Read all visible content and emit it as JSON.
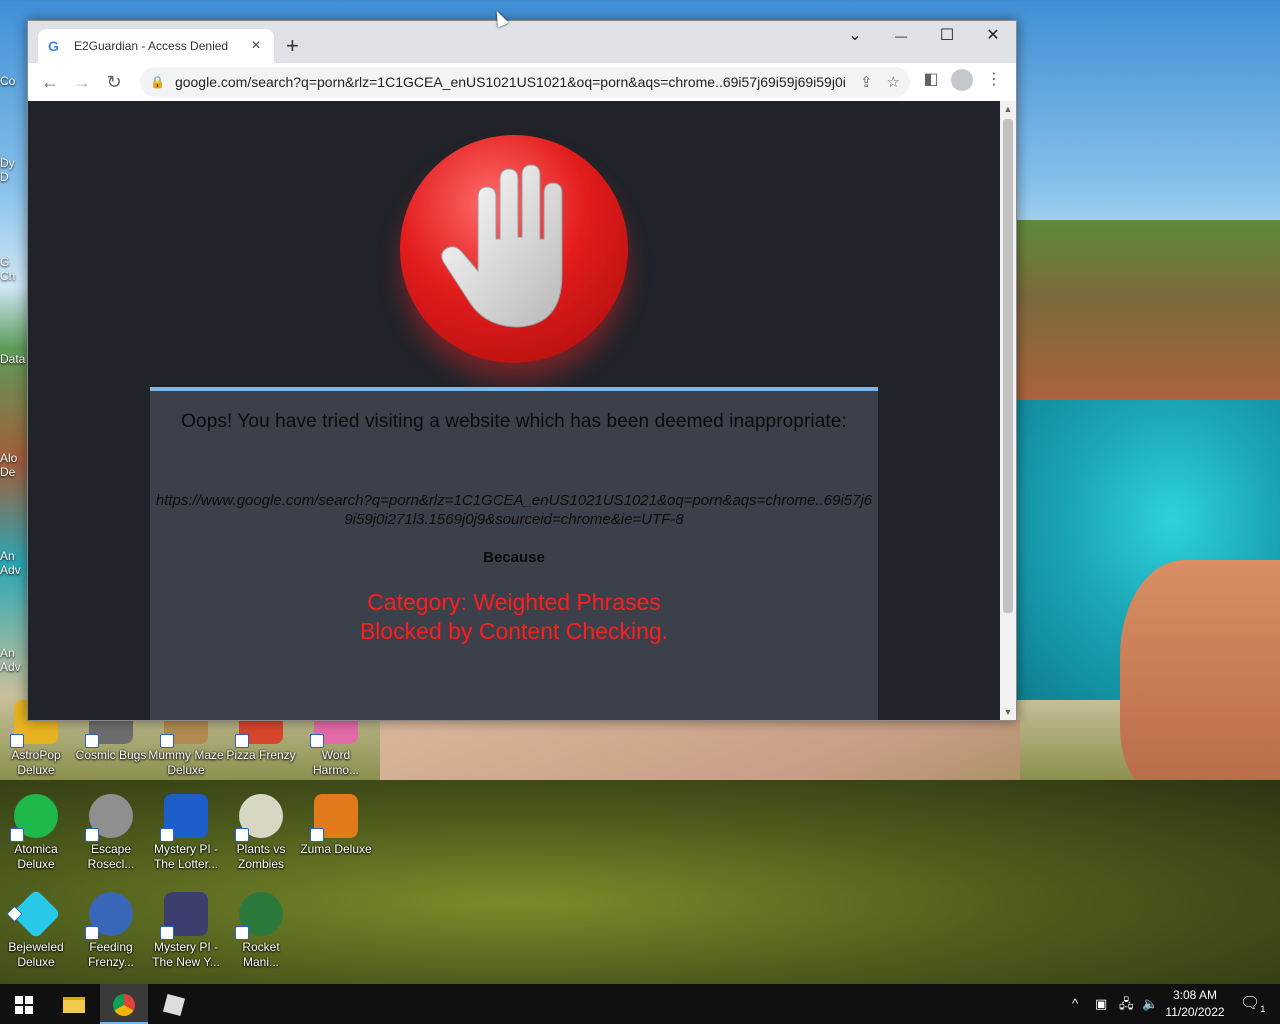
{
  "browser": {
    "tab_title": "E2Guardian - Access Denied",
    "tab_favicon": "G",
    "new_tab": "+",
    "url": "google.com/search?q=porn&rlz=1C1GCEA_enUS1021US1021&oq=porn&aqs=chrome..69i57j69i59j69i59j0i271l...",
    "window_controls": {
      "dropdown": "⌄",
      "minimize": "—",
      "maximize": "☐",
      "close": "✕"
    }
  },
  "blockpage": {
    "heading": "Oops! You have tried visiting a website which has been deemed inappropriate:",
    "blocked_url": "https://www.google.com/search?q=porn&rlz=1C1GCEA_enUS1021US1021&oq=porn&aqs=chrome..69i57j69i59j0i271l3.1569j0j9&sourceid=chrome&ie=UTF-8",
    "because": "Because",
    "reason_line1": "Category: Weighted Phrases",
    "reason_line2": "Blocked by Content Checking.",
    "accent_color": "#ff1d1d"
  },
  "desktop_icons": [
    {
      "label": "AstroPop Deluxe",
      "color": "#e8b320"
    },
    {
      "label": "Cosmic Bugs",
      "color": "#6d6d6d"
    },
    {
      "label": "Mummy Maze Deluxe",
      "color": "#b08a50"
    },
    {
      "label": "Pizza Frenzy",
      "color": "#d7462c"
    },
    {
      "label": "Word Harmo...",
      "color": "#e26aa7"
    },
    {
      "label": "Atomica Deluxe",
      "color": "#1fb84a"
    },
    {
      "label": "Escape Rosecl...",
      "color": "#8f8f8f"
    },
    {
      "label": "Mystery PI - The Lotter...",
      "color": "#1e5ec8"
    },
    {
      "label": "Plants vs Zombies",
      "color": "#d7d7c3"
    },
    {
      "label": "Zuma Deluxe",
      "color": "#e07a1a"
    },
    {
      "label": "Bejeweled Deluxe",
      "color": "#28c8e8"
    },
    {
      "label": "Feeding Frenzy...",
      "color": "#3a66b8"
    },
    {
      "label": "Mystery PI - The New Y...",
      "color": "#3b3f6d"
    },
    {
      "label": "Rocket Mani...",
      "color": "#2b7a3c"
    }
  ],
  "left_partial_labels": [
    "Co",
    "Dy",
    "D",
    "G",
    "Ch",
    "Data",
    "Alo",
    "De",
    "An",
    "Adv",
    "An",
    "Adv"
  ],
  "taskbar": {
    "time": "3:08 AM",
    "date": "11/20/2022",
    "notification_count": "1"
  }
}
